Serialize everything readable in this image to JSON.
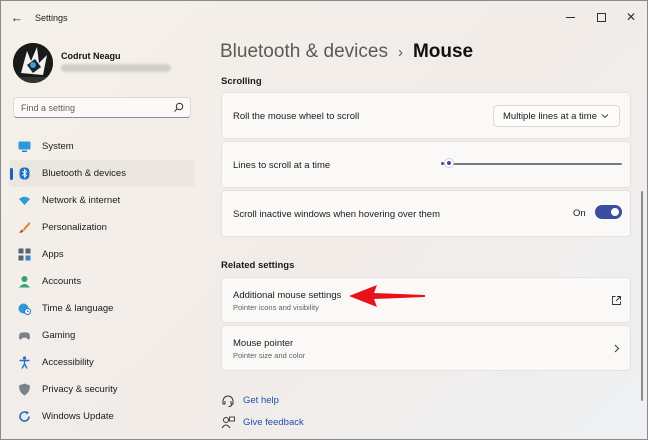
{
  "app": {
    "title": "Settings"
  },
  "user": {
    "name": "Codrut Neagu"
  },
  "search": {
    "placeholder": "Find a setting"
  },
  "nav": {
    "items": [
      {
        "label": "System",
        "icon": "monitor-icon"
      },
      {
        "label": "Bluetooth & devices",
        "icon": "bluetooth-icon",
        "active": true
      },
      {
        "label": "Network & internet",
        "icon": "wifi-icon"
      },
      {
        "label": "Personalization",
        "icon": "brush-icon"
      },
      {
        "label": "Apps",
        "icon": "apps-icon"
      },
      {
        "label": "Accounts",
        "icon": "person-icon"
      },
      {
        "label": "Time & language",
        "icon": "globe-clock-icon"
      },
      {
        "label": "Gaming",
        "icon": "gamepad-icon"
      },
      {
        "label": "Accessibility",
        "icon": "accessibility-icon"
      },
      {
        "label": "Privacy & security",
        "icon": "shield-icon"
      },
      {
        "label": "Windows Update",
        "icon": "update-icon"
      }
    ]
  },
  "breadcrumb": {
    "parent": "Bluetooth & devices",
    "separator": "›",
    "current": "Mouse"
  },
  "scrolling": {
    "heading": "Scrolling",
    "wheel": {
      "label": "Roll the mouse wheel to scroll",
      "value": "Multiple lines at a time"
    },
    "lines": {
      "label": "Lines to scroll at a time",
      "slider_fraction": 0.03
    },
    "inactive": {
      "label": "Scroll inactive windows when hovering over them",
      "state_label": "On",
      "on": true
    }
  },
  "related": {
    "heading": "Related settings",
    "additional": {
      "title": "Additional mouse settings",
      "subtitle": "Pointer icons and visibility"
    },
    "pointer": {
      "title": "Mouse pointer",
      "subtitle": "Pointer size and color"
    }
  },
  "help": {
    "get_help": "Get help",
    "give_feedback": "Give feedback"
  },
  "colors": {
    "accent": "#3b4ea0",
    "link": "#1f4fb0",
    "annotation_arrow": "#e8131a"
  }
}
